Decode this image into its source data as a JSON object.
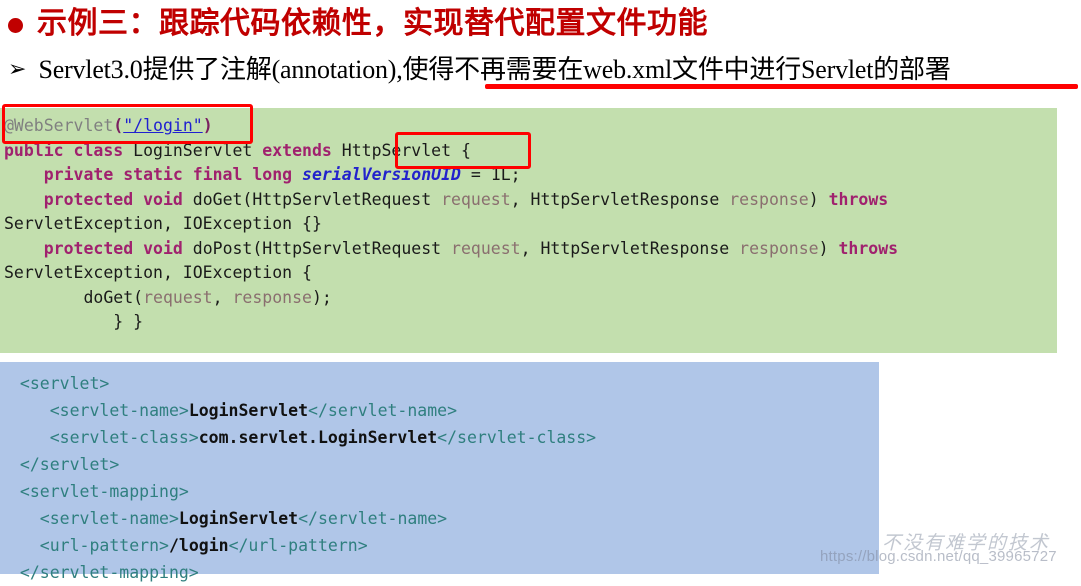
{
  "header": {
    "bullet_icon": "filled-circle-bullet",
    "title": "示例三：跟踪代码依赖性，实现替代配置文件功能",
    "title_color": "#c00000",
    "arrow_icon": "➢",
    "subtitle": "Servlet3.0提供了注解(annotation),使得不再需要在web.xml文件中进行Servlet的部署",
    "underline_color": "#ff0000"
  },
  "java_block": {
    "background_color": "#c3dfae",
    "lines": [
      {
        "id": "line-annotation",
        "tokens": [
          {
            "text": "@WebServlet",
            "style": "ann"
          },
          {
            "text": "(",
            "style": "punct"
          },
          {
            "text": "\"/login\"",
            "style": "str"
          },
          {
            "text": ")",
            "style": "punct"
          }
        ]
      },
      {
        "id": "line-class-decl",
        "tokens": [
          {
            "text": "public class ",
            "style": "kw"
          },
          {
            "text": "LoginServlet ",
            "style": "plain"
          },
          {
            "text": "extends ",
            "style": "kw"
          },
          {
            "text": "HttpServlet ",
            "style": "plain"
          },
          {
            "text": "{",
            "style": "plain"
          }
        ]
      },
      {
        "id": "line-serialversionuid",
        "tokens": [
          {
            "text": "    ",
            "style": "plain"
          },
          {
            "text": "private static final long ",
            "style": "kw"
          },
          {
            "text": "serialVersionUID",
            "style": "field"
          },
          {
            "text": " = 1L;",
            "style": "plain"
          }
        ]
      },
      {
        "id": "line-doget-sig",
        "tokens": [
          {
            "text": "    ",
            "style": "plain"
          },
          {
            "text": "protected void ",
            "style": "kw"
          },
          {
            "text": "doGet(HttpServletRequest ",
            "style": "plain"
          },
          {
            "text": "request",
            "style": "param"
          },
          {
            "text": ", HttpServletResponse ",
            "style": "plain"
          },
          {
            "text": "response",
            "style": "param"
          },
          {
            "text": ") ",
            "style": "plain"
          },
          {
            "text": "throws",
            "style": "kw"
          }
        ]
      },
      {
        "id": "line-doget-throws",
        "tokens": [
          {
            "text": "ServletException, IOException {}",
            "style": "plain"
          }
        ]
      },
      {
        "id": "line-dopost-sig",
        "tokens": [
          {
            "text": "    ",
            "style": "plain"
          },
          {
            "text": "protected void ",
            "style": "kw"
          },
          {
            "text": "doPost(HttpServletRequest ",
            "style": "plain"
          },
          {
            "text": "request",
            "style": "param"
          },
          {
            "text": ", HttpServletResponse ",
            "style": "plain"
          },
          {
            "text": "response",
            "style": "param"
          },
          {
            "text": ") ",
            "style": "plain"
          },
          {
            "text": "throws",
            "style": "kw"
          }
        ]
      },
      {
        "id": "line-dopost-throws",
        "tokens": [
          {
            "text": "ServletException, IOException {",
            "style": "plain"
          }
        ]
      },
      {
        "id": "line-doget-call",
        "tokens": [
          {
            "text": "        doGet(",
            "style": "plain"
          },
          {
            "text": "request",
            "style": "param"
          },
          {
            "text": ", ",
            "style": "plain"
          },
          {
            "text": "response",
            "style": "param"
          },
          {
            "text": ");",
            "style": "plain"
          }
        ]
      },
      {
        "id": "line-closing-braces",
        "tokens": [
          {
            "text": "           } }",
            "style": "plain"
          }
        ]
      }
    ]
  },
  "xml_block": {
    "background_color": "#b0c6e8",
    "lines": [
      {
        "id": "xml-servlet-open",
        "tokens": [
          {
            "text": " <servlet>",
            "style": "tag"
          }
        ]
      },
      {
        "id": "xml-servlet-name-1",
        "tokens": [
          {
            "text": "    <servlet-name>",
            "style": "tag"
          },
          {
            "text": "LoginServlet",
            "style": "val"
          },
          {
            "text": "</servlet-name>",
            "style": "tag"
          }
        ]
      },
      {
        "id": "xml-servlet-class",
        "tokens": [
          {
            "text": "    <servlet-class>",
            "style": "tag"
          },
          {
            "text": "com.servlet.LoginServlet",
            "style": "val"
          },
          {
            "text": "</servlet-class>",
            "style": "tag"
          }
        ]
      },
      {
        "id": "xml-servlet-close",
        "tokens": [
          {
            "text": " </servlet>",
            "style": "tag"
          }
        ]
      },
      {
        "id": "xml-mapping-open",
        "tokens": [
          {
            "text": " <servlet-mapping>",
            "style": "tag"
          }
        ]
      },
      {
        "id": "xml-servlet-name-2",
        "tokens": [
          {
            "text": "   <servlet-name>",
            "style": "tag"
          },
          {
            "text": "LoginServlet",
            "style": "val"
          },
          {
            "text": "</servlet-name>",
            "style": "tag"
          }
        ]
      },
      {
        "id": "xml-url-pattern",
        "tokens": [
          {
            "text": "   <url-pattern>",
            "style": "tag"
          },
          {
            "text": "/login",
            "style": "val"
          },
          {
            "text": "</url-pattern>",
            "style": "tag"
          }
        ]
      },
      {
        "id": "xml-mapping-close",
        "tokens": [
          {
            "text": " </servlet-mapping>",
            "style": "tag"
          }
        ]
      }
    ]
  },
  "annotations": {
    "box_color": "#ff0000",
    "webservlet_box_label": "@WebServlet(\"/login\")",
    "httpservlet_box_label": "HttpServlet"
  },
  "watermark": {
    "url": "https://blog.csdn.net/qq_39965727",
    "calligraphy": "不没有难学的技术"
  }
}
